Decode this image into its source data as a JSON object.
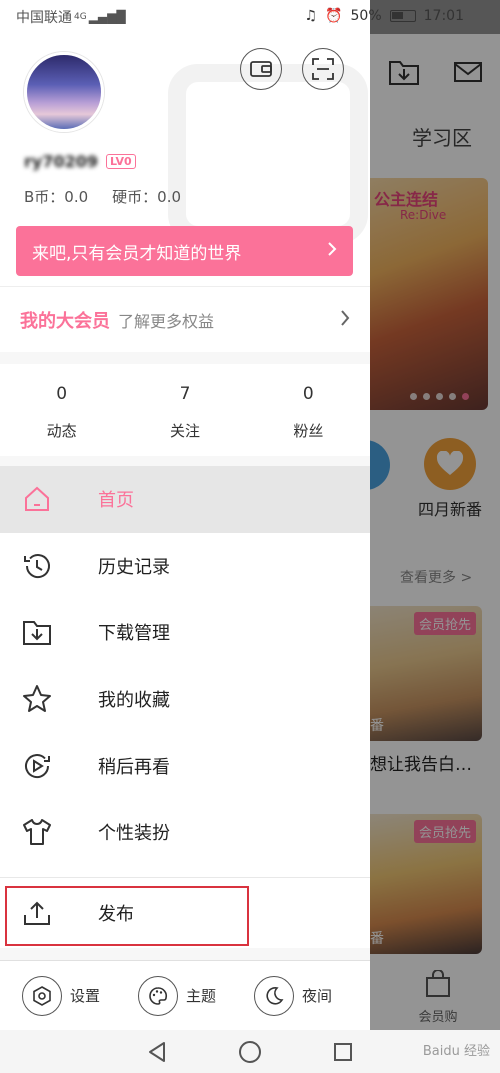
{
  "status_bar": {
    "carrier": "中国联通",
    "network": "4G",
    "battery": "50%",
    "time": "17:01"
  },
  "background": {
    "tab_label": "学习区",
    "banner_title": "公主连结",
    "banner_subtitle": "Re:Dive",
    "heart_label": "四月新番",
    "see_more": "查看更多 >",
    "card_badge": "会员抢先",
    "card_caption": "想让我告白…",
    "card_sub": "番",
    "bottom_label": "会员购"
  },
  "drawer": {
    "username": "ry70209",
    "level": "LV0",
    "b_coins": "B币：0.0",
    "coins": "硬币：0.0",
    "vip_banner": "来吧,只有会员才知道的世界",
    "vip_title": "我的大会员",
    "vip_subtitle": "了解更多权益",
    "stats": [
      {
        "value": "0",
        "label": "动态"
      },
      {
        "value": "7",
        "label": "关注"
      },
      {
        "value": "0",
        "label": "粉丝"
      }
    ],
    "menu": [
      {
        "label": "首页",
        "icon": "home-icon"
      },
      {
        "label": "历史记录",
        "icon": "history-icon"
      },
      {
        "label": "下载管理",
        "icon": "download-icon"
      },
      {
        "label": "我的收藏",
        "icon": "star-icon"
      },
      {
        "label": "稍后再看",
        "icon": "watch-later-icon"
      },
      {
        "label": "个性装扮",
        "icon": "tshirt-icon"
      }
    ],
    "publish": "发布",
    "footer": [
      {
        "label": "设置",
        "icon": "settings-icon"
      },
      {
        "label": "主题",
        "icon": "palette-icon"
      },
      {
        "label": "夜间",
        "icon": "moon-icon"
      }
    ]
  },
  "watermark": "Baidu 经验",
  "colors": {
    "brand_pink": "#fb7299",
    "highlight_red": "#d9333f"
  }
}
